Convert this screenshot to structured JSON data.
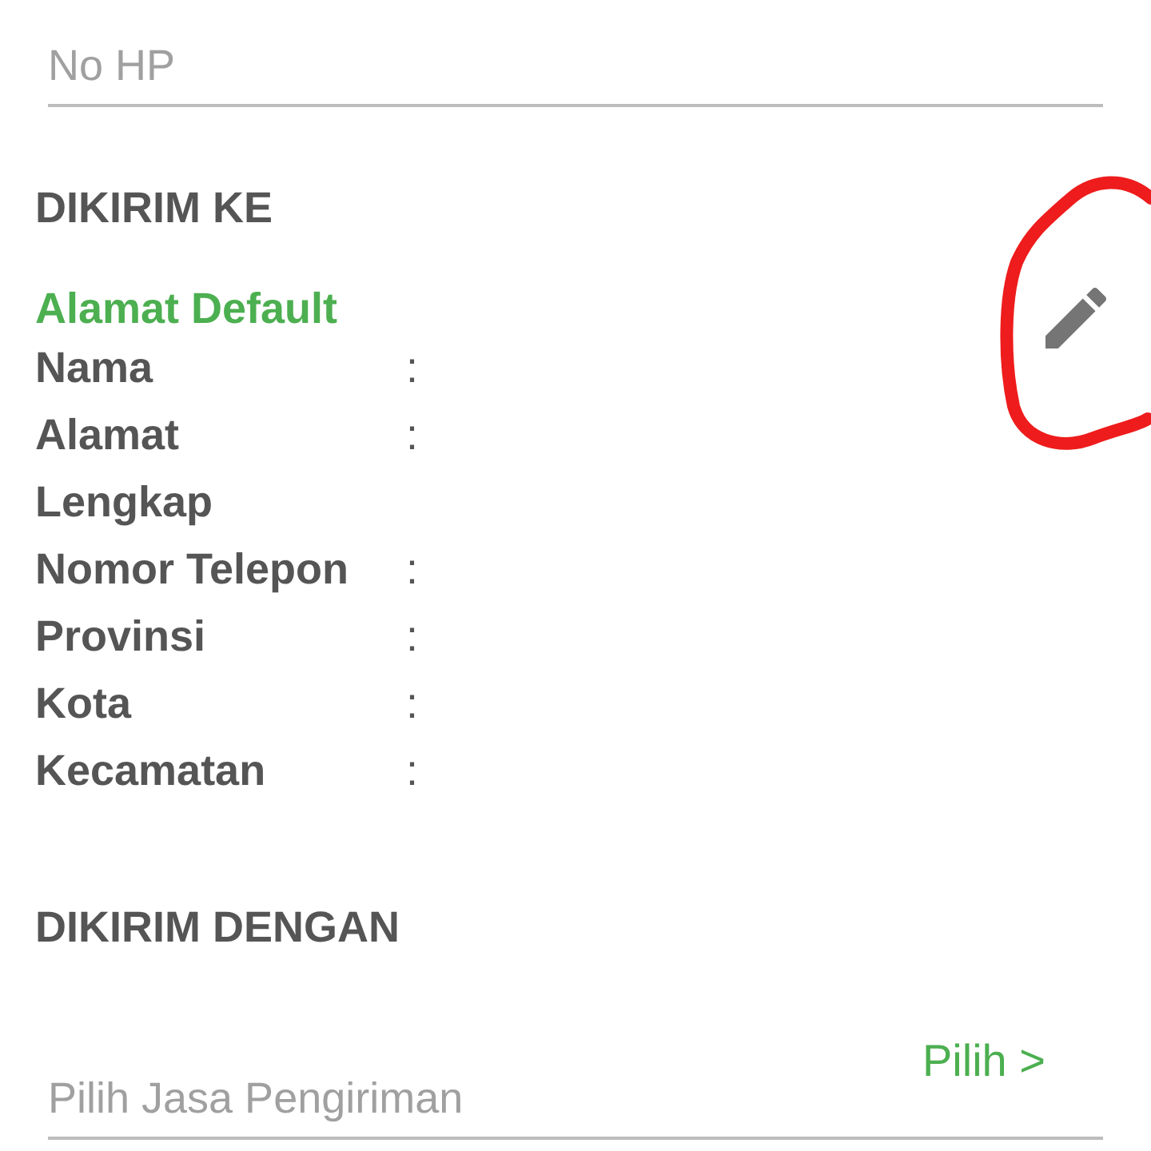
{
  "phone_field": {
    "placeholder": "No HP"
  },
  "shipping_to": {
    "heading": "DIKIRIM KE",
    "address_label": "Alamat Default",
    "fields": [
      {
        "label": "Nama",
        "separator": ":"
      },
      {
        "label": "Alamat Lengkap",
        "separator": ":"
      },
      {
        "label": "Nomor Telepon",
        "separator": ":"
      },
      {
        "label": "Provinsi",
        "separator": ":"
      },
      {
        "label": "Kota",
        "separator": ":"
      },
      {
        "label": "Kecamatan",
        "separator": ":"
      }
    ]
  },
  "shipping_with": {
    "heading": "DIKIRIM DENGAN",
    "field": {
      "placeholder": "Pilih Jasa Pengiriman"
    },
    "action": "Pilih >"
  }
}
